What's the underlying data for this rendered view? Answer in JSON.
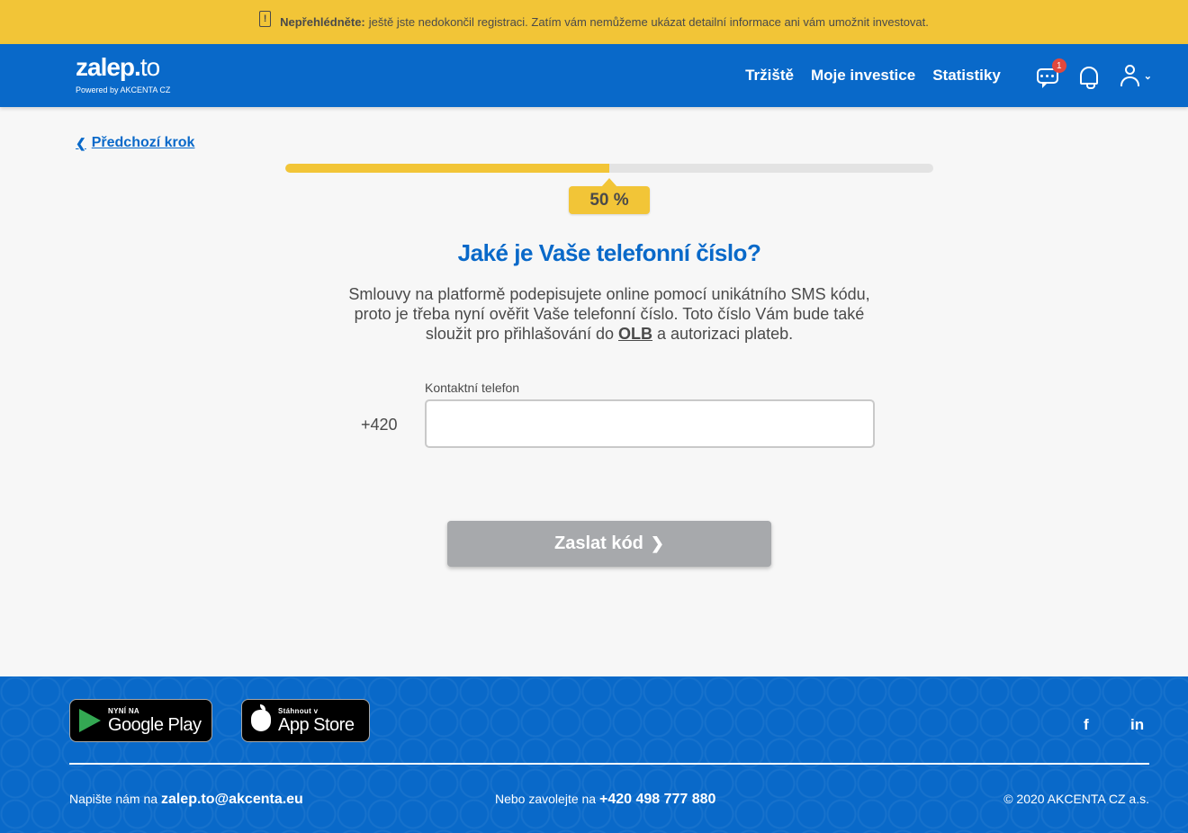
{
  "alert": {
    "strong": "Nepřehlédněte:",
    "text": "ještě jste nedokončil registraci. Zatím vám nemůžeme ukázat detailní informace ani vám umožnit investovat."
  },
  "header": {
    "logo": {
      "word": "zalep.",
      "word_to": "to",
      "sub": "Powered by AKCENTA CZ"
    },
    "nav": [
      "Tržiště",
      "Moje investice",
      "Statistiky"
    ],
    "chat_badge": "1"
  },
  "back": {
    "label": "Předchozí krok"
  },
  "progress": {
    "value": 0.5,
    "label": "50 %",
    "color": "#f2c537"
  },
  "form": {
    "title": "Jaké je Vaše telefonní číslo?",
    "desc_1": "Smlouvy na platformě podepisujete online pomocí unikátního SMS kódu, proto je třeba nyní ověřit Vaše telefonní číslo. Toto číslo Vám bude také sloužit pro přihlašování do ",
    "desc_olb": "OLB",
    "desc_2": " a autorizaci plateb.",
    "phone_label": "Kontaktní telefon",
    "phone_prefix": "+420",
    "phone_value": "",
    "submit": "Zaslat kód"
  },
  "footer": {
    "google_play": {
      "small": "NYNÍ NA",
      "big": "Google Play"
    },
    "app_store": {
      "small": "Stáhnout v",
      "big": "App Store"
    },
    "social": {
      "facebook": "f",
      "linkedin": "in"
    },
    "write_prefix": "Napište nám na ",
    "email": "zalep.to@akcenta.eu",
    "call_prefix": "Nebo zavolejte na ",
    "phone": "+420 498 777 880",
    "copyright": "© 2020 AKCENTA CZ a.s."
  },
  "colors": {
    "brand_blue": "#0969c9",
    "accent_yellow": "#f2c537",
    "button_disabled": "#a7a9ac"
  }
}
